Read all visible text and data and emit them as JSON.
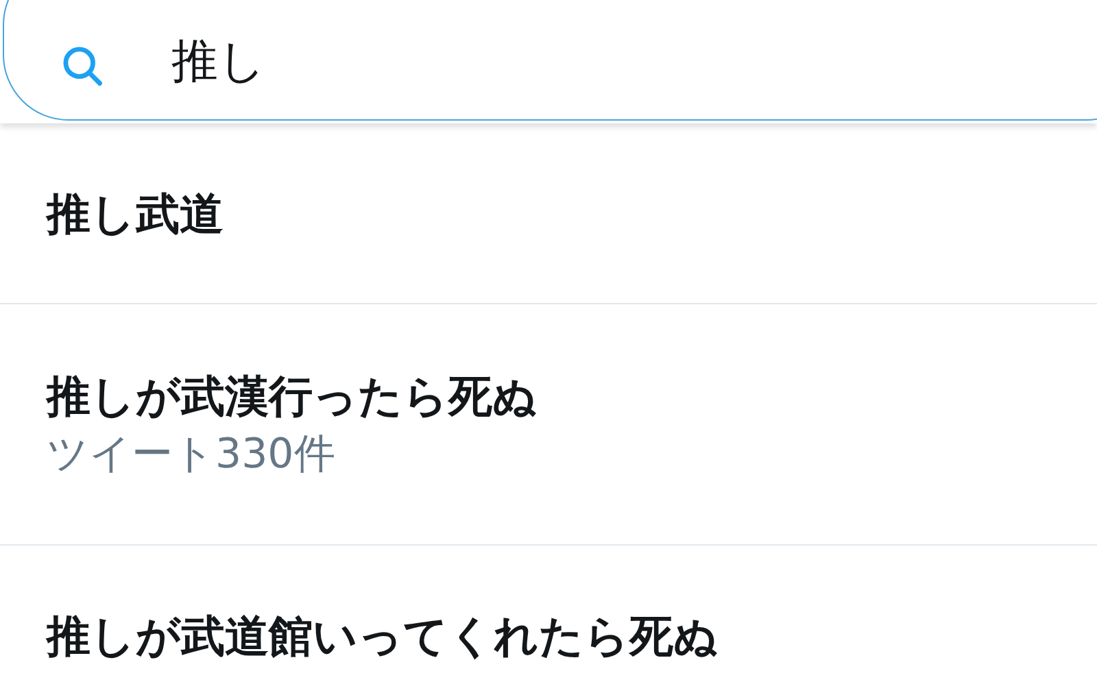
{
  "search": {
    "value": "推し"
  },
  "suggestions": [
    {
      "title": "推し武道"
    },
    {
      "title": "推しが武漢行ったら死ぬ",
      "subtitle": "ツイート330件"
    },
    {
      "title": "推しが武道館いってくれたら死ぬ"
    }
  ]
}
